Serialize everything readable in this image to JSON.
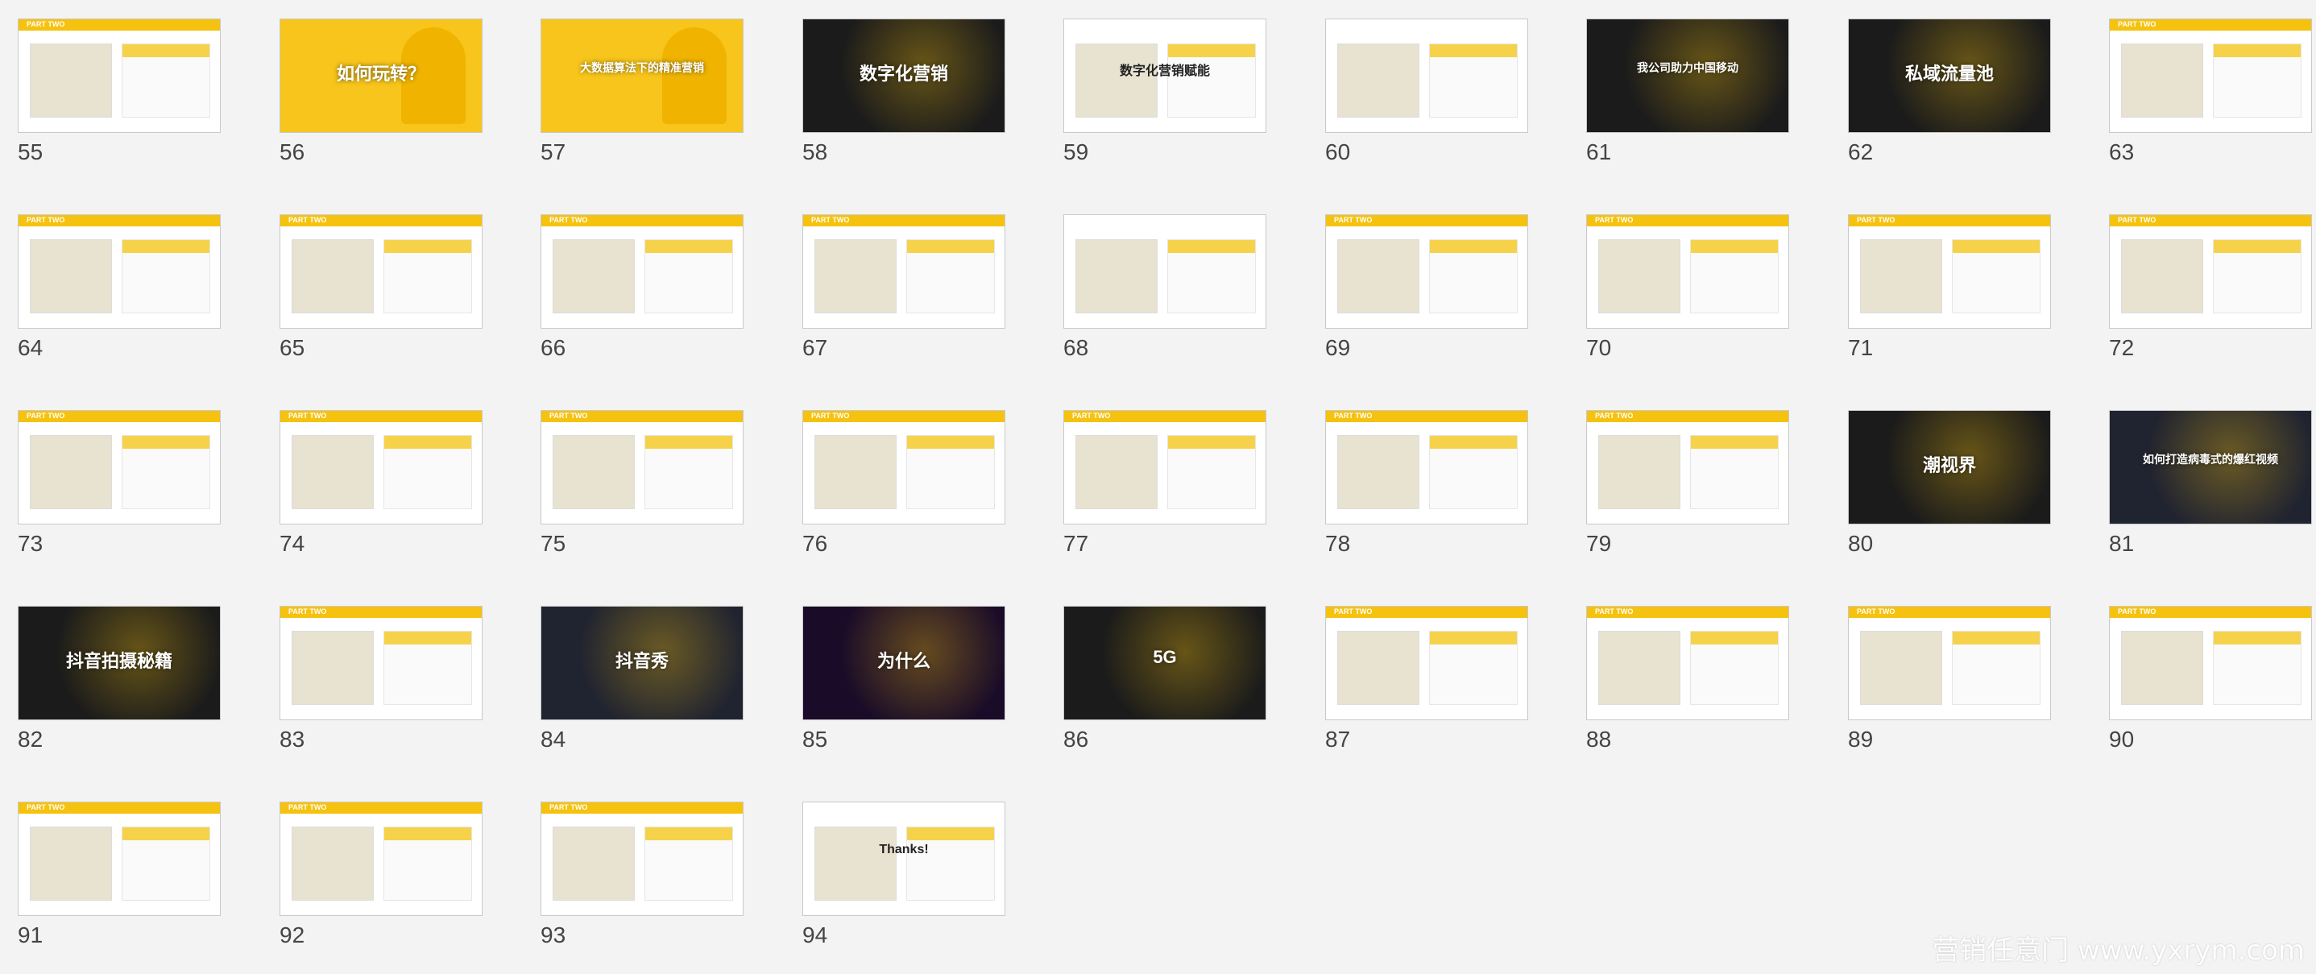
{
  "watermark": "营销任意门 www.yxrym.com",
  "slides": [
    {
      "num": "55",
      "style": "white",
      "bar": "PART TWO",
      "caption": ""
    },
    {
      "num": "56",
      "style": "yellow",
      "bar": "",
      "caption": "如何玩转？"
    },
    {
      "num": "57",
      "style": "yellow",
      "bar": "",
      "caption": "大数据算法下的精准营销"
    },
    {
      "num": "58",
      "style": "dark",
      "bar": "",
      "caption": "数字化营销"
    },
    {
      "num": "59",
      "style": "white",
      "bar": "",
      "caption": "数字化营销赋能"
    },
    {
      "num": "60",
      "style": "white",
      "bar": "",
      "caption": ""
    },
    {
      "num": "61",
      "style": "dark",
      "bar": "",
      "caption": "我公司助力中国移动"
    },
    {
      "num": "62",
      "style": "dark",
      "bar": "",
      "caption": "私域流量池"
    },
    {
      "num": "63",
      "style": "white",
      "bar": "PART TWO",
      "caption": ""
    },
    {
      "num": "64",
      "style": "white",
      "bar": "PART TWO",
      "caption": ""
    },
    {
      "num": "65",
      "style": "white",
      "bar": "PART TWO",
      "caption": ""
    },
    {
      "num": "66",
      "style": "white",
      "bar": "PART TWO",
      "caption": ""
    },
    {
      "num": "67",
      "style": "white",
      "bar": "PART TWO",
      "caption": ""
    },
    {
      "num": "68",
      "style": "white",
      "bar": "",
      "caption": ""
    },
    {
      "num": "69",
      "style": "white",
      "bar": "PART TWO",
      "caption": ""
    },
    {
      "num": "70",
      "style": "white",
      "bar": "PART TWO",
      "caption": ""
    },
    {
      "num": "71",
      "style": "white",
      "bar": "PART TWO",
      "caption": ""
    },
    {
      "num": "72",
      "style": "white",
      "bar": "PART TWO",
      "caption": ""
    },
    {
      "num": "73",
      "style": "white",
      "bar": "PART TWO",
      "caption": ""
    },
    {
      "num": "74",
      "style": "white",
      "bar": "PART TWO",
      "caption": ""
    },
    {
      "num": "75",
      "style": "white",
      "bar": "PART TWO",
      "caption": ""
    },
    {
      "num": "76",
      "style": "white",
      "bar": "PART TWO",
      "caption": ""
    },
    {
      "num": "77",
      "style": "white",
      "bar": "PART TWO",
      "caption": ""
    },
    {
      "num": "78",
      "style": "white",
      "bar": "PART TWO",
      "caption": ""
    },
    {
      "num": "79",
      "style": "white",
      "bar": "PART TWO",
      "caption": ""
    },
    {
      "num": "80",
      "style": "dark",
      "bar": "",
      "caption": "潮视界"
    },
    {
      "num": "81",
      "style": "night",
      "bar": "",
      "caption": "如何打造病毒式的爆红视频"
    },
    {
      "num": "82",
      "style": "dark",
      "bar": "",
      "caption": "抖音拍摄秘籍"
    },
    {
      "num": "83",
      "style": "white",
      "bar": "PART TWO",
      "caption": ""
    },
    {
      "num": "84",
      "style": "night",
      "bar": "",
      "caption": "抖音秀"
    },
    {
      "num": "85",
      "style": "purple",
      "bar": "",
      "caption": "为什么"
    },
    {
      "num": "86",
      "style": "dark",
      "bar": "",
      "caption": "5G"
    },
    {
      "num": "87",
      "style": "white",
      "bar": "PART TWO",
      "caption": ""
    },
    {
      "num": "88",
      "style": "white",
      "bar": "PART TWO",
      "caption": ""
    },
    {
      "num": "89",
      "style": "white",
      "bar": "PART TWO",
      "caption": ""
    },
    {
      "num": "90",
      "style": "white",
      "bar": "PART TWO",
      "caption": ""
    },
    {
      "num": "91",
      "style": "white",
      "bar": "PART TWO",
      "caption": ""
    },
    {
      "num": "92",
      "style": "white",
      "bar": "PART TWO",
      "caption": ""
    },
    {
      "num": "93",
      "style": "white",
      "bar": "PART TWO",
      "caption": ""
    },
    {
      "num": "94",
      "style": "white",
      "bar": "",
      "caption": "Thanks!"
    }
  ]
}
